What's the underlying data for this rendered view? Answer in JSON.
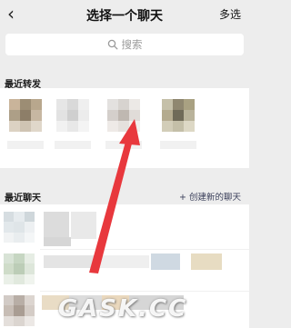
{
  "header": {
    "back_icon": "‹",
    "title": "选择一个聊天",
    "multi_select_label": "多选"
  },
  "search": {
    "placeholder": "搜索",
    "icon": "search-icon"
  },
  "recent_forward": {
    "section_label": "最近转发",
    "avatars": [
      {
        "colors": [
          "#c9b49a",
          "#9c8d74",
          "#b8a78d",
          "#ad9f87",
          "#8d7e68",
          "#c7b7a2",
          "#dcd2c3",
          "#cfc4b3",
          "#e0d7ca"
        ]
      },
      {
        "colors": [
          "#e6e6e6",
          "#d9d9d9",
          "#efefef",
          "#e2e2e2",
          "#cfcfcf",
          "#ececec",
          "#f1f1f1",
          "#e8e8e8",
          "#f4f4f4"
        ]
      },
      {
        "colors": [
          "#e3e1df",
          "#d7d3cf",
          "#ece9e6",
          "#d4cfcb",
          "#bfb8b1",
          "#e0dcd8",
          "#eeeae7",
          "#e5e1dd",
          "#f2efec"
        ]
      },
      {
        "colors": [
          "#c5c0a9",
          "#8f8770",
          "#a9a182",
          "#b4ab8f",
          "#6f6a58",
          "#b9b39b",
          "#d2cdb8",
          "#c4bfa8",
          "#ddd8c5"
        ]
      }
    ]
  },
  "recent_chats": {
    "section_label": "最近聊天",
    "create_label": "+ 创建新的聊天",
    "rows": [
      {
        "avatar_colors": [
          "#d6dde1",
          "#e6ebee",
          "#cfd7db",
          "#e2e8eb",
          "#dfe5e8",
          "#edf0f2",
          "#f1f3f4",
          "#e9edef",
          "#f4f6f7"
        ],
        "blocks": [
          "#dcdcdc",
          "#e9e9e9",
          "#d6d6d6"
        ]
      },
      {
        "avatar_colors": [
          "#d8e3d6",
          "#c6d6c2",
          "#e6ede4",
          "#cfdcc9",
          "#bccdb7",
          "#dde6da",
          "#eaf0e8",
          "#e1e9de",
          "#f0f4ee"
        ],
        "blocks": [
          "#e4e4e4",
          "#efefef",
          "#cfd9e2",
          "#e7dcc2"
        ]
      },
      {
        "avatar_colors": [
          "#d2cbc6",
          "#b8aea6",
          "#dcd5d0",
          "#c7bdb5",
          "#a99d93",
          "#d4ccc6",
          "#e4dfdb",
          "#dbd5d0",
          "#ece8e5"
        ],
        "blocks": [
          "#e9dcc5",
          "#ead8bd",
          "#dcdcdc",
          "#d6d6d6"
        ]
      }
    ]
  },
  "watermark": {
    "text": "GASK.CC"
  }
}
